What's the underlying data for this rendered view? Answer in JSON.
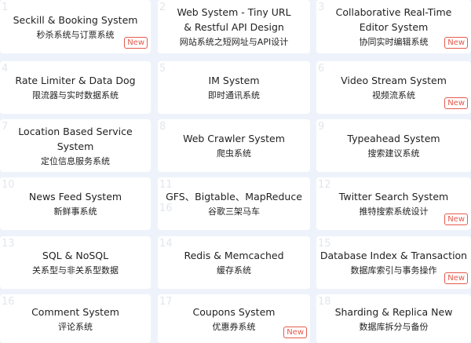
{
  "cards": [
    {
      "num": "1",
      "en": [
        "Seckill & Booking System"
      ],
      "cn": "秒杀系统与订票系统",
      "badge": "New"
    },
    {
      "num": "2",
      "en": [
        "Web System - Tiny URL",
        "& Restful API Design"
      ],
      "cn": "网站系统之短网址与API设计",
      "badge": ""
    },
    {
      "num": "3",
      "en": [
        "Collaborative Real-Time",
        "Editor System"
      ],
      "cn": "协同实时编辑系统",
      "badge": "New"
    },
    {
      "num": "4",
      "en": [
        "Rate Limiter & Data Dog"
      ],
      "cn": "限流器与实时数据系统",
      "badge": ""
    },
    {
      "num": "5",
      "en": [
        "IM System"
      ],
      "cn": "即时通讯系统",
      "badge": ""
    },
    {
      "num": "6",
      "en": [
        "Video Stream System"
      ],
      "cn": "视频流系统",
      "badge": "New"
    },
    {
      "num": "7",
      "en": [
        "Location Based Service System"
      ],
      "cn": "定位信息服务系统",
      "badge": ""
    },
    {
      "num": "8",
      "en": [
        "Web Crawler System"
      ],
      "cn": "爬虫系统",
      "badge": ""
    },
    {
      "num": "9",
      "en": [
        "Typeahead System"
      ],
      "cn": "搜索建议系统",
      "badge": ""
    },
    {
      "num": "10",
      "en": [
        "News Feed System"
      ],
      "cn": "新鲜事系统",
      "badge": ""
    },
    {
      "num": "11",
      "num2": "16",
      "en": [
        "GFS、Bigtable、MapReduce"
      ],
      "cn": "谷歌三架马车",
      "badge": ""
    },
    {
      "num": "12",
      "en": [
        "Twitter Search System"
      ],
      "cn": "推特搜索系统设计",
      "badge": "New"
    },
    {
      "num": "13",
      "en": [
        "SQL & NoSQL"
      ],
      "cn": "关系型与非关系型数据",
      "badge": ""
    },
    {
      "num": "14",
      "en": [
        "Redis & Memcached"
      ],
      "cn": "缓存系统",
      "badge": ""
    },
    {
      "num": "15",
      "en": [
        "Database Index & Transaction"
      ],
      "cn": "数据库索引与事务操作",
      "badge": "New"
    },
    {
      "num": "16",
      "en": [
        "Comment System"
      ],
      "cn": "评论系统",
      "badge": ""
    },
    {
      "num": "17",
      "en": [
        "Coupons System"
      ],
      "cn": "优惠券系统",
      "badge": "New"
    },
    {
      "num": "18",
      "en": [
        "Sharding & Replica New"
      ],
      "cn": "数据库拆分与备份",
      "badge": ""
    }
  ]
}
